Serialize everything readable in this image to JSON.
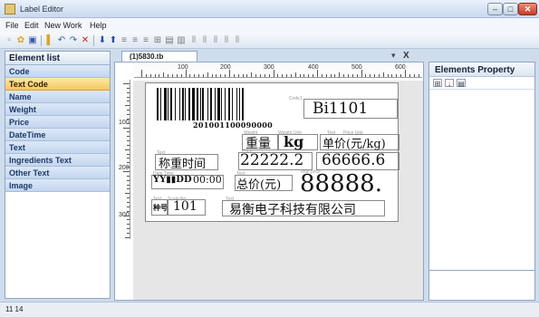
{
  "window": {
    "title": "Label Editor"
  },
  "menu": [
    "File",
    "Edit",
    "New Work",
    "Help"
  ],
  "left_panel": {
    "header": "Element list",
    "items": [
      "Code",
      "Text Code",
      "Name",
      "Weight",
      "Price",
      "DateTime",
      "Text",
      "Ingredients Text",
      "Other Text",
      "Image"
    ],
    "active_index": 1
  },
  "document": {
    "tab_title": "(1)5830.tb",
    "pin": "▾",
    "close": "X"
  },
  "ruler": {
    "h_labels": [
      "100",
      "200",
      "300",
      "400",
      "500",
      "600"
    ],
    "v_labels": [
      "100",
      "200",
      "300"
    ]
  },
  "label": {
    "barcode_digits": "201001100090000",
    "plu_code": "Bi1101",
    "weight_label": "重量",
    "weight_unit": "kg",
    "unit_price_label": "单价(元/kg)",
    "name_label": "称重时间",
    "weight_value": "22222.2",
    "unit_price_value": "66666.6",
    "date_value": "YY▮▮DD",
    "time_value": "00:00",
    "total_label": "总价(元)",
    "total_value": "88888.",
    "plu_label": "种号",
    "plu_value": "101",
    "company": "易衡电子科技有限公司",
    "tiny": {
      "code": "Code1",
      "weight_unit_hint": "Weight Unit",
      "price_unit_hint": "Price Unit",
      "weight_hint": "Weight",
      "price_hint": "Price",
      "text_hint": "Text",
      "date_hint": "Date Time",
      "total_hint": "Total price",
      "scale_hint": "Scale No."
    }
  },
  "right_panel": {
    "header": "Elements Property"
  },
  "status": {
    "text": "11 14"
  }
}
